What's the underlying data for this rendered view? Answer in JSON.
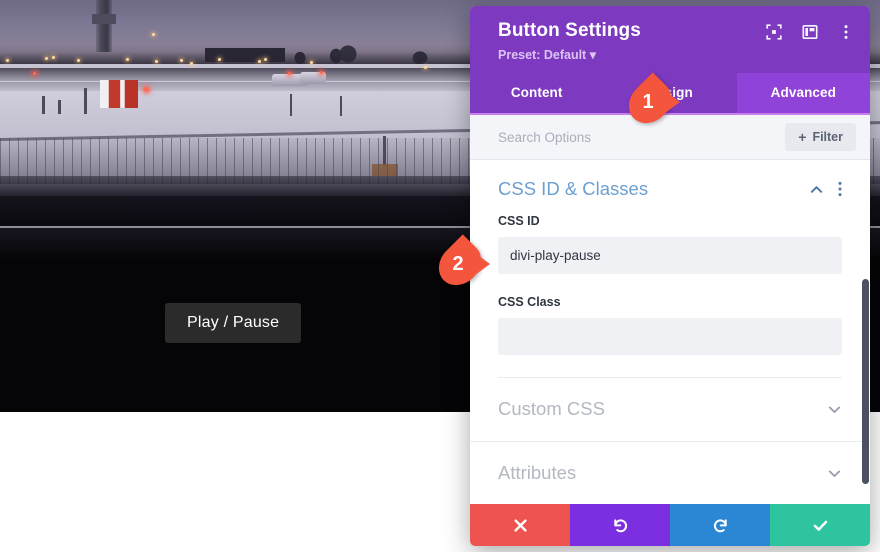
{
  "canvas": {
    "video": {
      "scene_description": "snowy airfield at dusk",
      "play_pause_label": "Play / Pause"
    }
  },
  "modal": {
    "title": "Button Settings",
    "preset": "Preset: Default ▾",
    "header_icons": [
      {
        "name": "focus-icon"
      },
      {
        "name": "layout-panel-icon"
      },
      {
        "name": "more-options-icon"
      }
    ],
    "tabs": [
      {
        "label": "Content",
        "active": false
      },
      {
        "label": "Design",
        "active": false
      },
      {
        "label": "Advanced",
        "active": true
      }
    ],
    "search": {
      "placeholder": "Search Options",
      "value": ""
    },
    "filter_button": {
      "label": "Filter",
      "plus": "+"
    },
    "sections": [
      {
        "title": "CSS ID & Classes",
        "state": "expanded",
        "fields": [
          {
            "label": "CSS ID",
            "value": "divi-play-pause",
            "placeholder": ""
          },
          {
            "label": "CSS Class",
            "value": "",
            "placeholder": ""
          }
        ]
      },
      {
        "title": "Custom CSS",
        "state": "collapsed"
      },
      {
        "title": "Attributes",
        "state": "collapsed"
      }
    ],
    "actions": [
      {
        "name": "cancel-button",
        "icon": "close-icon",
        "color": "#ef5350"
      },
      {
        "name": "undo-button",
        "icon": "undo-icon",
        "color": "#7b2fe0"
      },
      {
        "name": "redo-button",
        "icon": "redo-icon",
        "color": "#2b87d4"
      },
      {
        "name": "save-button",
        "icon": "check-icon",
        "color": "#2ec4a0"
      }
    ]
  },
  "callouts": [
    {
      "number": "1",
      "target": "advanced-tab"
    },
    {
      "number": "2",
      "target": "css-id-input"
    }
  ],
  "colors": {
    "header_purple": "#7d3ac1",
    "active_tab_purple": "#9043d8",
    "section_title_blue": "#6c9fd1",
    "marker_orange": "#f4553d"
  }
}
